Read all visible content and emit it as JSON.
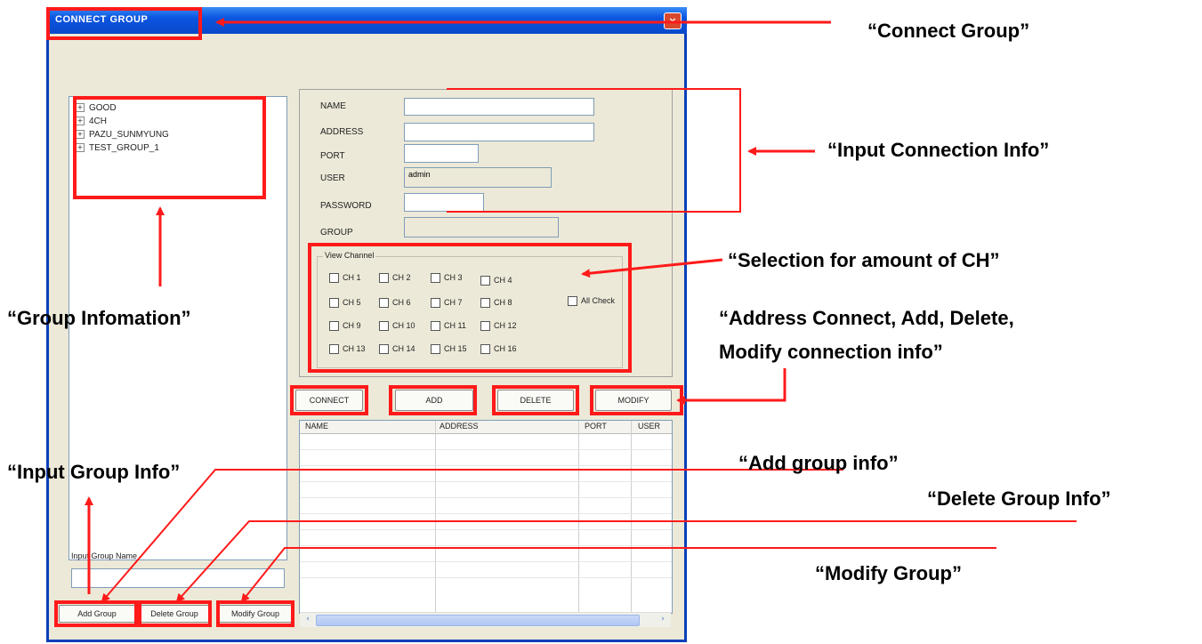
{
  "window": {
    "title": "CONNECT GROUP",
    "close_glyph": "×"
  },
  "tree": {
    "expander_glyph": "+",
    "items": [
      "GOOD",
      "4CH",
      "PAZU_SUNMYUNG",
      "TEST_GROUP_1"
    ]
  },
  "group_input": {
    "label": "Input Group Name",
    "value": ""
  },
  "group_buttons": {
    "add": "Add Group",
    "delete": "Delete Group",
    "modify": "Modify Group"
  },
  "connection_form": {
    "name_label": "NAME",
    "address_label": "ADDRESS",
    "port_label": "PORT",
    "user_label": "USER",
    "user_value": "admin",
    "password_label": "PASSWORD",
    "group_label": "GROUP"
  },
  "view_channel": {
    "title": "View Channel",
    "channels": [
      "CH 1",
      "CH 2",
      "CH 3",
      "CH 4",
      "CH 5",
      "CH 6",
      "CH 7",
      "CH 8",
      "CH 9",
      "CH 10",
      "CH 11",
      "CH 12",
      "CH 13",
      "CH 14",
      "CH 15",
      "CH 16"
    ],
    "all_check": "All Check"
  },
  "action_buttons": {
    "connect": "CONNECT",
    "add": "ADD",
    "delete": "DELETE",
    "modify": "MODIFY"
  },
  "table": {
    "columns": [
      "NAME",
      "ADDRESS",
      "PORT",
      "USER"
    ]
  },
  "scroll": {
    "left_arrow": "‹",
    "right_arrow": "›"
  },
  "annotations": {
    "connect_group": "“Connect Group”",
    "input_connection_info": "“Input Connection Info”",
    "selection_ch": "“Selection for amount of CH”",
    "group_information": "“Group Infomation”",
    "address_connect_1": "“Address Connect, Add, Delete,",
    "address_connect_2": "Modify connection info”",
    "input_group_info": "“Input Group Info”",
    "add_group_info": "“Add group info”",
    "delete_group_info": "“Delete Group Info”",
    "modify_group": "“Modify Group”"
  },
  "colors": {
    "annotation_red": "#ff1a1a",
    "titlebar_blue": "#0b55e0",
    "window_bg": "#ece9d8"
  }
}
